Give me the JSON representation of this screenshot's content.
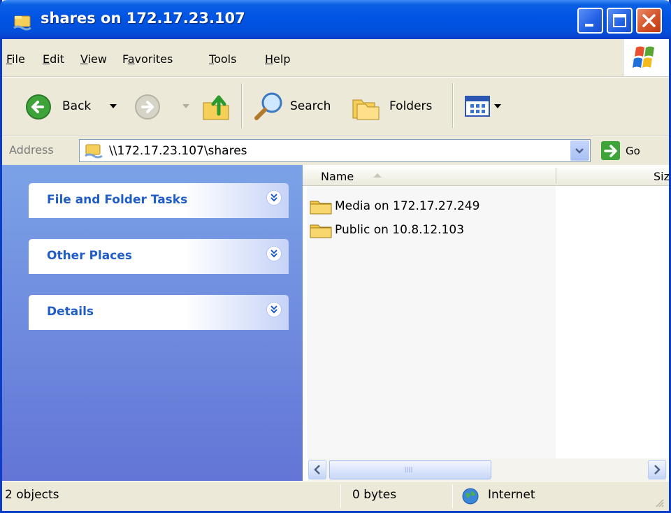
{
  "window": {
    "title": "shares on 172.17.23.107",
    "title_icon": "network-share-icon",
    "controls": [
      "minimize",
      "maximize",
      "close"
    ]
  },
  "menu": {
    "items": [
      {
        "label": "File",
        "mnemonic": "F"
      },
      {
        "label": "Edit",
        "mnemonic": "E"
      },
      {
        "label": "View",
        "mnemonic": "V"
      },
      {
        "label": "Favorites",
        "mnemonic": "a"
      },
      {
        "label": "Tools",
        "mnemonic": "T"
      },
      {
        "label": "Help",
        "mnemonic": "H"
      }
    ],
    "logo_icon": "windows-logo-icon"
  },
  "toolbar": {
    "back_label": "Back",
    "search_label": "Search",
    "folders_label": "Folders"
  },
  "address": {
    "label": "Address",
    "value": "\\\\172.17.23.107\\shares",
    "go_label": "Go"
  },
  "taskpane": {
    "panels": [
      {
        "title": "File and Folder Tasks"
      },
      {
        "title": "Other Places"
      },
      {
        "title": "Details"
      }
    ]
  },
  "filelist": {
    "columns": [
      "Name",
      "Siz"
    ],
    "sorted_column": "Name",
    "items": [
      {
        "name": "Media on 172.17.27.249",
        "icon": "shared-folder-icon"
      },
      {
        "name": "Public on 10.8.12.103",
        "icon": "shared-folder-icon"
      }
    ]
  },
  "status": {
    "objects": "2 objects",
    "size": "0 bytes",
    "zone": "Internet"
  },
  "colors": {
    "titlebar": "#0054e3",
    "taskpane_top": "#7ba2e7",
    "taskpane_bottom": "#6375d6",
    "task_title": "#215dc6",
    "chrome": "#ece9d8"
  }
}
